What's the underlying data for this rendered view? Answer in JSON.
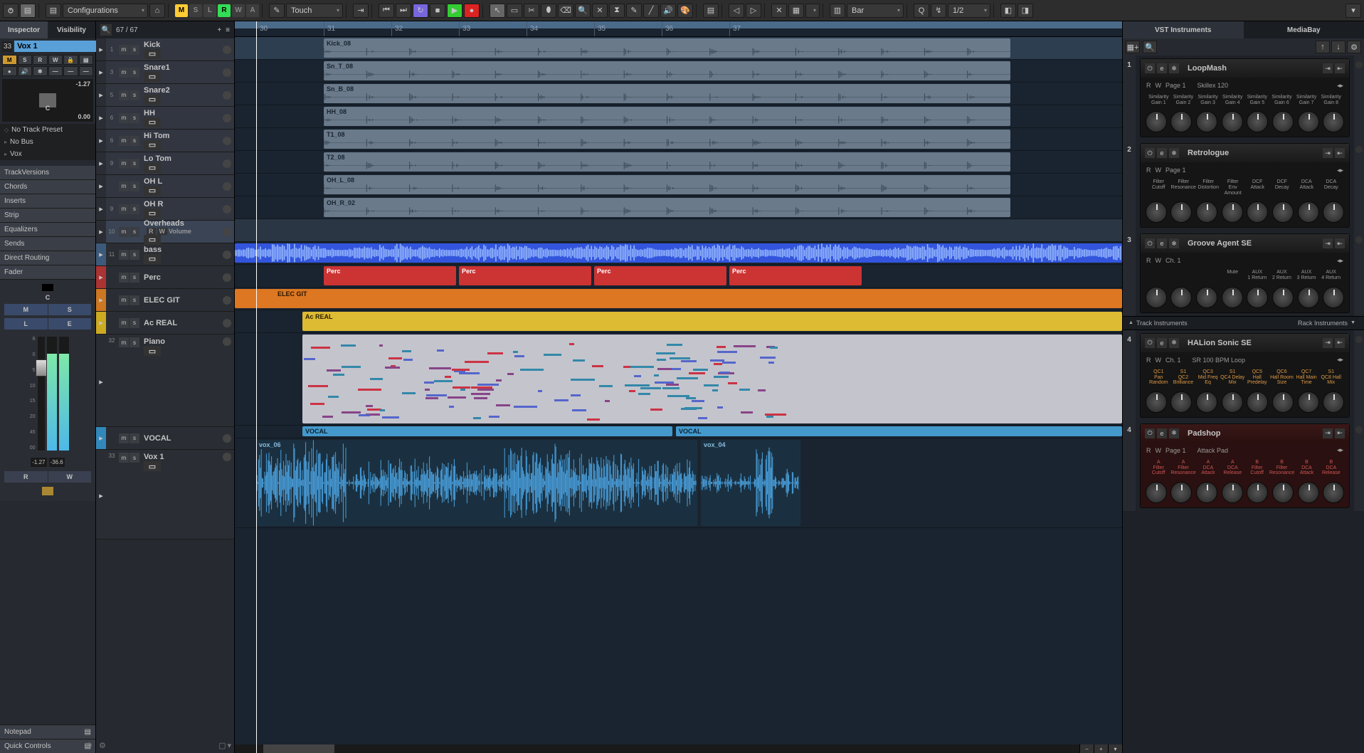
{
  "toolbar": {
    "config_label": "Configurations",
    "toggles": [
      "M",
      "S",
      "L",
      "R",
      "W",
      "A"
    ],
    "automation_mode": "Touch",
    "grid_label": "Bar",
    "quantize": "Q",
    "quantize_val": "1/2"
  },
  "inspector": {
    "tabs": [
      "Inspector",
      "Visibility"
    ],
    "track_num": "33",
    "track_name": "Vox 1",
    "pan_val": "-1.27",
    "pan_label": "C",
    "vol_val": "0.00",
    "no_preset": "No Track Preset",
    "no_bus": "No Bus",
    "routing": "Vox",
    "sections": [
      "TrackVersions",
      "Chords",
      "Inserts",
      "Strip",
      "Equalizers",
      "Sends",
      "Direct Routing",
      "Fader"
    ],
    "chan": {
      "c": "C",
      "m": "M",
      "s": "S",
      "l": "L",
      "e": "E",
      "r": "R",
      "w": "W"
    },
    "scale": [
      "6",
      "0",
      "5",
      "10",
      "15",
      "20",
      "45",
      "00"
    ],
    "peak_l": "-1.27",
    "peak_r": "-36.6",
    "bottom": [
      "Notepad",
      "Quick Controls"
    ]
  },
  "tracklist": {
    "counter": "67 / 67",
    "tracks": [
      {
        "num": "1",
        "name": "Kick",
        "type": "drum"
      },
      {
        "num": "3",
        "name": "Snare1",
        "type": "drum"
      },
      {
        "num": "5",
        "name": "Snare2",
        "type": "drum"
      },
      {
        "num": "6",
        "name": "HH",
        "type": "drum"
      },
      {
        "num": "6",
        "name": "Hi Tom",
        "type": "drum"
      },
      {
        "num": "9",
        "name": "Lo Tom",
        "type": "drum"
      },
      {
        "num": "",
        "name": "OH L",
        "type": "drum"
      },
      {
        "num": "9",
        "name": "OH R",
        "type": "drum"
      },
      {
        "num": "10",
        "name": "Overheads",
        "type": "drum",
        "selected": true,
        "sub": "Volume"
      },
      {
        "num": "11",
        "name": "bass",
        "type": "bass"
      },
      {
        "num": "",
        "name": "Perc",
        "type": "folder-red"
      },
      {
        "num": "",
        "name": "ELEC GIT",
        "type": "folder-orange"
      },
      {
        "num": "",
        "name": "Ac REAL",
        "type": "folder-yellow"
      },
      {
        "num": "32",
        "name": "Piano",
        "type": "piano"
      },
      {
        "num": "",
        "name": "VOCAL",
        "type": "folder-blue"
      },
      {
        "num": "33",
        "name": "Vox 1",
        "type": "vox"
      }
    ]
  },
  "arrange": {
    "bars": [
      "30",
      "31",
      "32",
      "33",
      "34",
      "35",
      "36",
      "37"
    ],
    "clips": {
      "drums": [
        {
          "label": "Kick_08"
        },
        {
          "label": "Sn_T_08"
        },
        {
          "label": "Sn_B_08"
        },
        {
          "label": "HH_08"
        },
        {
          "label": "T1_08"
        },
        {
          "label": "T2_08"
        },
        {
          "label": "OH_L_08"
        },
        {
          "label": "OH_R_02"
        }
      ],
      "perc": "Perc",
      "elec": "ELEC GIT",
      "ac": "Ac REAL",
      "vocal": "VOCAL",
      "vox": [
        "vox_06",
        "vox_04"
      ]
    }
  },
  "rack": {
    "tabs": [
      "VST Instruments",
      "MediaBay"
    ],
    "divider_l": "Track Instruments",
    "divider_r": "Rack Instruments",
    "instruments": [
      {
        "num": "1",
        "name": "LoopMash",
        "preset": "Skillex 120",
        "page": "Page 1",
        "labels": [
          "Similarity Gain 1",
          "Similarity Gain 2",
          "Similarity Gain 3",
          "Similarity Gain 4",
          "Similarity Gain 5",
          "Similarity Gain 6",
          "Similarity Gain 7",
          "Similarity Gain 8"
        ]
      },
      {
        "num": "2",
        "name": "Retrologue",
        "preset": "",
        "page": "Page 1",
        "labels": [
          "Filter Cutoff",
          "Filter Resonance",
          "Filter Distortion",
          "Filter Env Amount",
          "DCF Attack",
          "DCF Decay",
          "DCA Attack",
          "DCA Decay"
        ]
      },
      {
        "num": "3",
        "name": "Groove Agent SE",
        "preset": "",
        "page": "Ch. 1",
        "labels": [
          "",
          "",
          "",
          "Mute",
          "AUX 1 Return",
          "AUX 2 Return",
          "AUX 3 Return",
          "AUX 4 Return"
        ]
      },
      {
        "num": "4",
        "name": "HALion Sonic SE",
        "preset": "SR 100 BPM Loop",
        "page": "Ch. 1",
        "labels": [
          "QC1 Pan Random",
          "S1 QC2 Brilliance",
          "QC3 Mid Freq Eq",
          "S1 QC4 Delay Mix",
          "QC5 Hall Predelay",
          "QC6 Hall Room Size",
          "QC7 Hall Main Time",
          "S1 QC8 Hall Mix"
        ],
        "orange": true
      },
      {
        "num": "4",
        "name": "Padshop",
        "preset": "Attack Pad",
        "page": "Page 1",
        "labels": [
          "A Filter Cutoff",
          "A Filter Resonance",
          "A DCA Attack",
          "A DCA Release",
          "B Filter Cutoff",
          "B Filter Resonance",
          "B DCA Attack",
          "B DCA Release"
        ],
        "red": true
      }
    ]
  }
}
